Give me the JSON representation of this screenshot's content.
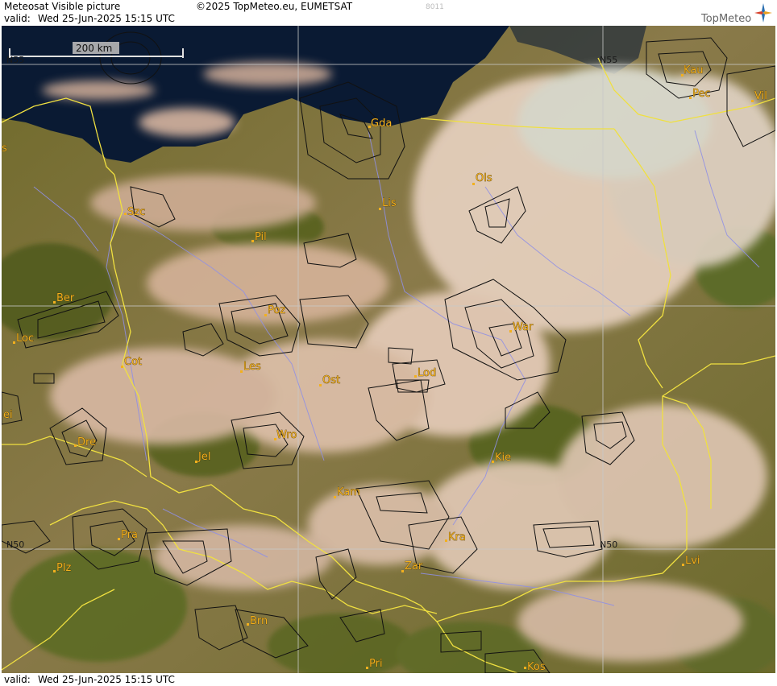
{
  "header": {
    "product_title": "Meteosat Visible picture",
    "copyright": "©2025 TopMeteo.eu, EUMETSAT",
    "frame_code": "8011",
    "valid_label": "valid:",
    "valid_datetime": "Wed  25-Jun-2025  15:15 UTC",
    "logo_text": "TopMeteo"
  },
  "footer": {
    "valid_label": "valid:",
    "valid_datetime": "Wed  25-Jun-2025  15:15 UTC"
  },
  "map": {
    "scale_bar_label": "200 km",
    "lat_labels": {
      "n55_top": "N55",
      "n55_right": "N55",
      "n50_left": "N50",
      "n50_right": "N50"
    },
    "cities": {
      "gda": "Gda",
      "ols": "Ols",
      "lis": "Lis",
      "szc": "Szc",
      "pil": "Pil",
      "kau": "Kau",
      "pec": "Pec",
      "vil": "Vil",
      "ber": "Ber",
      "loc": "Loc",
      "poz": "Poz",
      "war": "War",
      "cot": "Cot",
      "les": "Les",
      "ost": "Ost",
      "lod": "Lod",
      "dre": "Dre",
      "wro": "Wro",
      "jel": "Jel",
      "kie": "Kie",
      "kam": "Kam",
      "pra": "Pra",
      "kra": "Kra",
      "lvi": "Lvi",
      "plz": "Plz",
      "zar": "Zar",
      "brn": "Brn",
      "pri": "Pri",
      "kos": "Kos",
      "lei": "ei",
      "sea": "s"
    },
    "colors": {
      "border": "#f0e040",
      "river": "#8f8fe6",
      "grid": "#c8c8c8",
      "city": "#f2b01e",
      "sea": "#0a1a33"
    }
  }
}
